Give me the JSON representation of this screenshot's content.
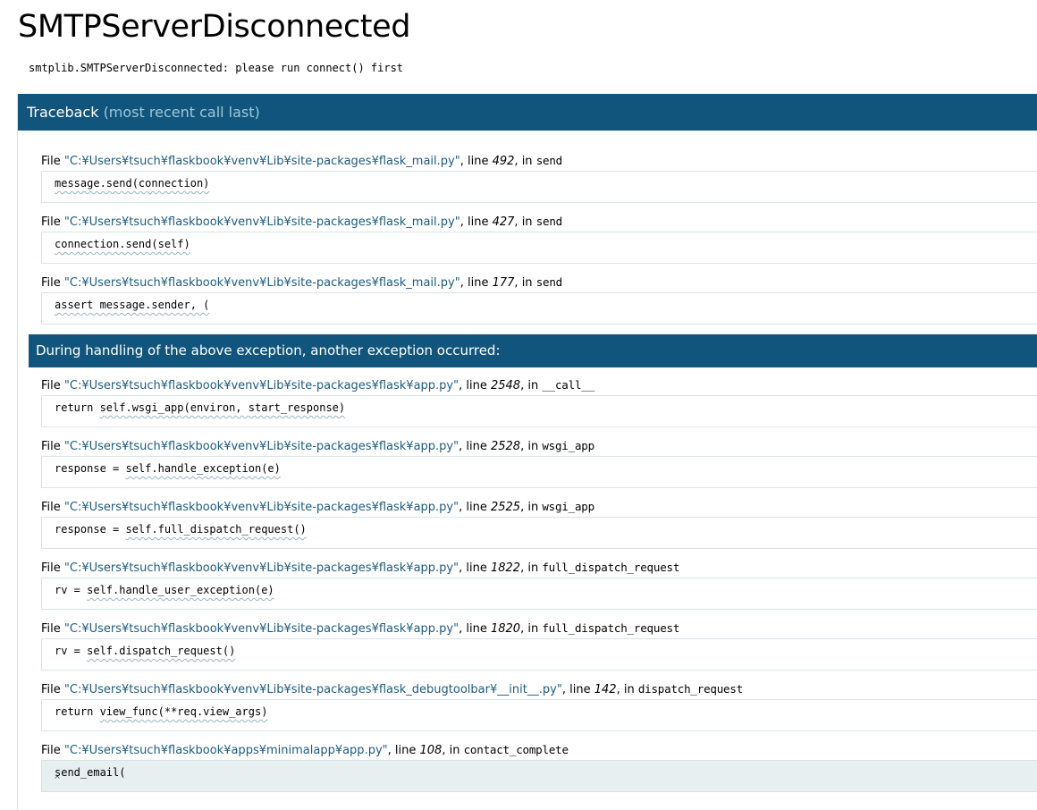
{
  "error": {
    "title": "SMTPServerDisconnected",
    "message": "smtplib.SMTPServerDisconnected: please run connect() first"
  },
  "traceback": {
    "header_label": "Traceback",
    "header_hint": "(most recent call last)",
    "divider_text": "During handling of the above exception, another exception occurred:",
    "file_word": "File",
    "line_word": "line",
    "in_word": "in",
    "group1": [
      {
        "file": "\"C:¥Users¥tsuch¥flaskbook¥venv¥Lib¥site-packages¥flask_mail.py\"",
        "line": "492",
        "func": "send",
        "code_plain": "",
        "code_squiggle": "message.send(connection)",
        "code_tail": ""
      },
      {
        "file": "\"C:¥Users¥tsuch¥flaskbook¥venv¥Lib¥site-packages¥flask_mail.py\"",
        "line": "427",
        "func": "send",
        "code_plain": "",
        "code_squiggle": "connection.send(self)",
        "code_tail": ""
      },
      {
        "file": "\"C:¥Users¥tsuch¥flaskbook¥venv¥Lib¥site-packages¥flask_mail.py\"",
        "line": "177",
        "func": "send",
        "code_plain": "",
        "code_squiggle": "assert message.sender, (",
        "code_tail": ""
      }
    ],
    "group2": [
      {
        "file": "\"C:¥Users¥tsuch¥flaskbook¥venv¥Lib¥site-packages¥flask¥app.py\"",
        "line": "2548",
        "func": "__call__",
        "code_plain": "return ",
        "code_squiggle": "self.wsgi_app(environ, start_response)",
        "code_tail": ""
      },
      {
        "file": "\"C:¥Users¥tsuch¥flaskbook¥venv¥Lib¥site-packages¥flask¥app.py\"",
        "line": "2528",
        "func": "wsgi_app",
        "code_plain": "response = ",
        "code_squiggle": "self.handle_exception(e)",
        "code_tail": ""
      },
      {
        "file": "\"C:¥Users¥tsuch¥flaskbook¥venv¥Lib¥site-packages¥flask¥app.py\"",
        "line": "2525",
        "func": "wsgi_app",
        "code_plain": "response = ",
        "code_squiggle": "self.full_dispatch_request()",
        "code_tail": ""
      },
      {
        "file": "\"C:¥Users¥tsuch¥flaskbook¥venv¥Lib¥site-packages¥flask¥app.py\"",
        "line": "1822",
        "func": "full_dispatch_request",
        "code_plain": "rv = ",
        "code_squiggle": "self.handle_user_exception(e)",
        "code_tail": ""
      },
      {
        "file": "\"C:¥Users¥tsuch¥flaskbook¥venv¥Lib¥site-packages¥flask¥app.py\"",
        "line": "1820",
        "func": "full_dispatch_request",
        "code_plain": "rv = ",
        "code_squiggle": "self.dispatch_request()",
        "code_tail": ""
      },
      {
        "file": "\"C:¥Users¥tsuch¥flaskbook¥venv¥Lib¥site-packages¥flask_debugtoolbar¥__init__.py\"",
        "line": "142",
        "func": "dispatch_request",
        "code_plain": "return ",
        "code_squiggle": "view_func(**req.view_args)",
        "code_tail": ""
      },
      {
        "file": "\"C:¥Users¥tsuch¥flaskbook¥apps¥minimalapp¥app.py\"",
        "line": "108",
        "func": "contact_complete",
        "code_plain": "",
        "code_squiggle": "",
        "code_tail": "send_email(",
        "caret": "^"
      }
    ]
  },
  "colors": {
    "header_bg": "#11557c",
    "header_hint": "#9cc8dd",
    "filename": "#1e5b7e",
    "current_frame_bg": "#e8eff0",
    "frame_border": "#d8e4e8"
  }
}
